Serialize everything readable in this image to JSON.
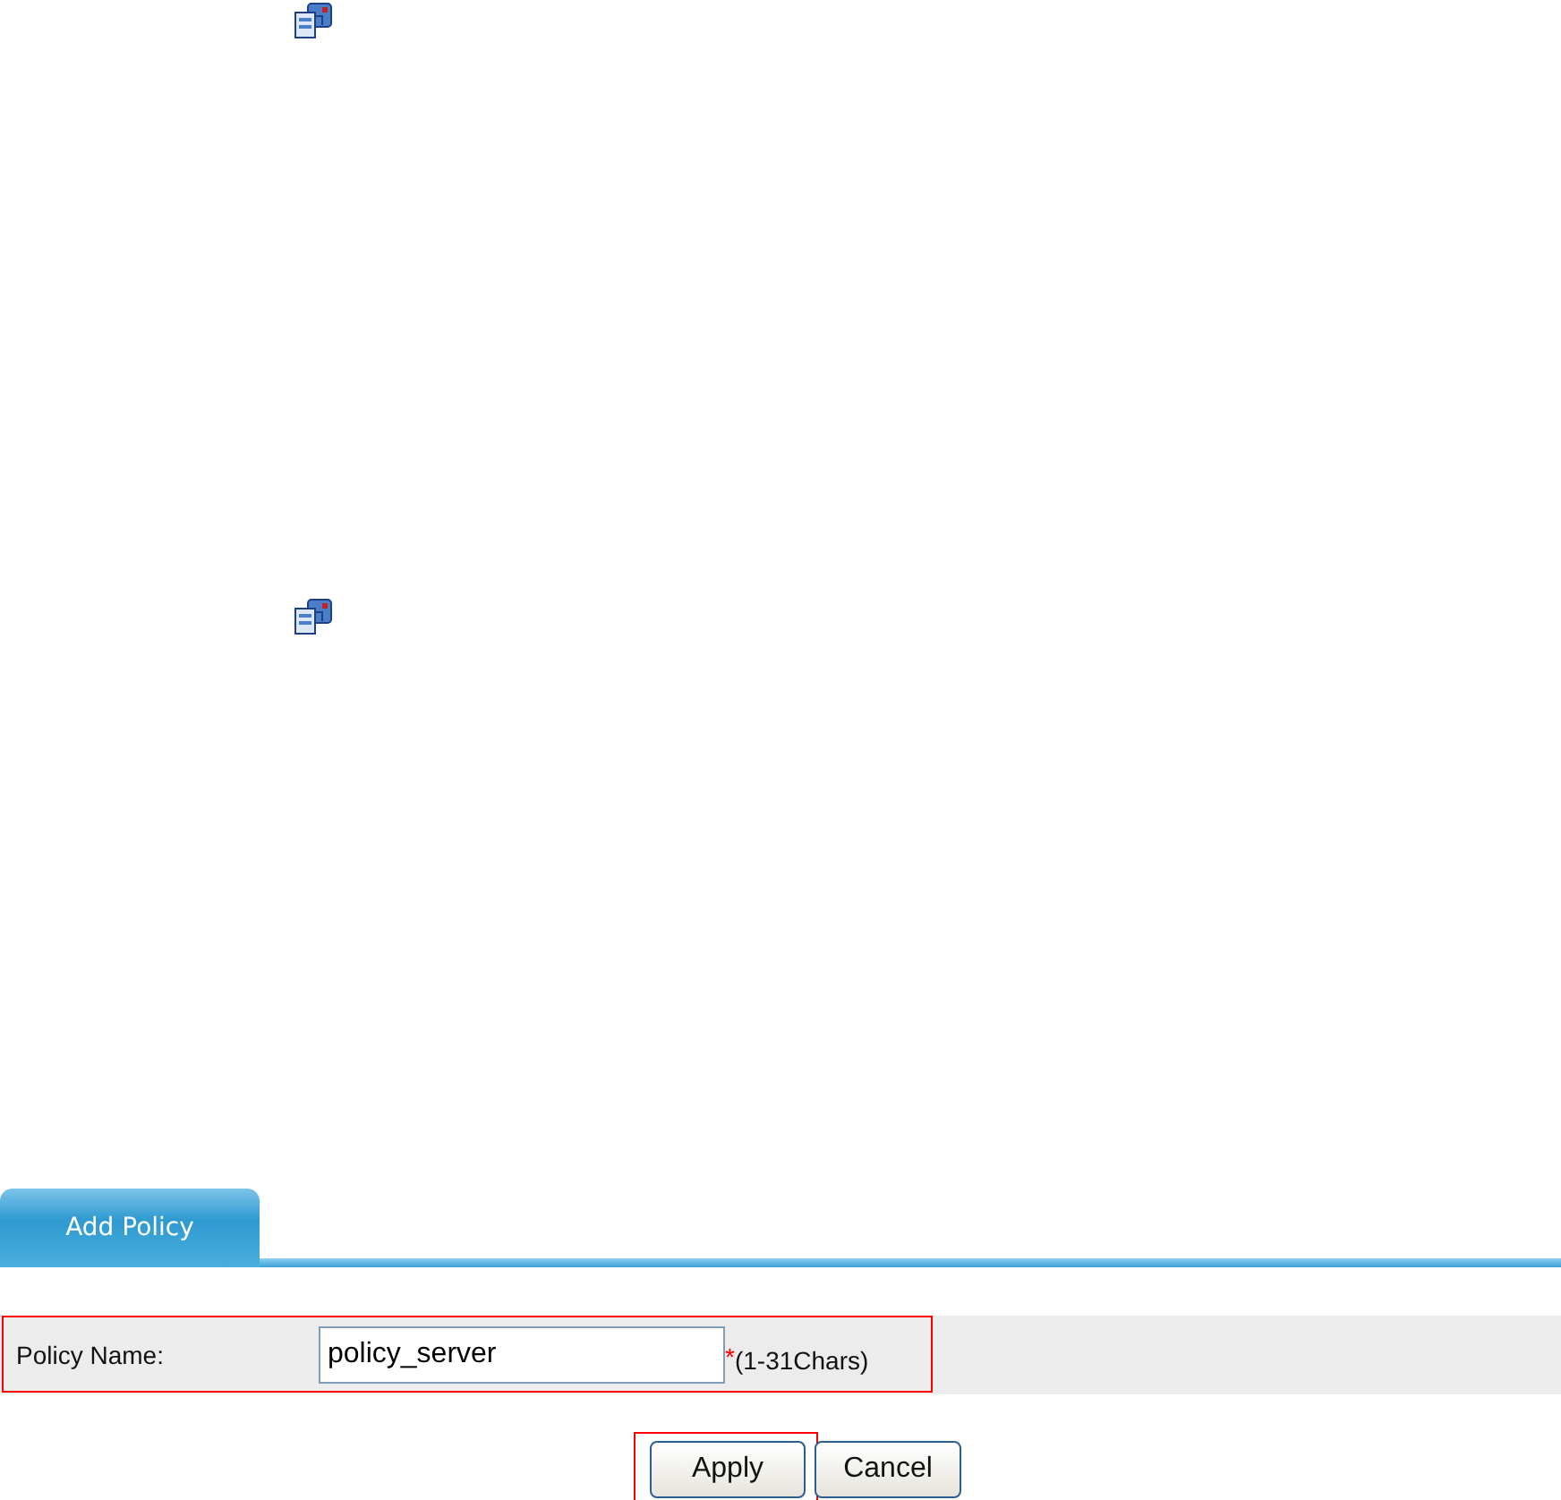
{
  "icons": [
    {
      "kind": "server"
    },
    {
      "kind": "server"
    }
  ],
  "tabs": [
    {
      "label": "Add Policy",
      "selected": true
    }
  ],
  "fields": [
    {
      "label": "Policy Name:",
      "value": "policy_server",
      "required_mark": "*",
      "hint": "(1-31Chars)",
      "highlighted": true
    }
  ],
  "buttons": [
    {
      "label": "Apply",
      "highlighted": true
    },
    {
      "label": "Cancel",
      "highlighted": false
    }
  ]
}
